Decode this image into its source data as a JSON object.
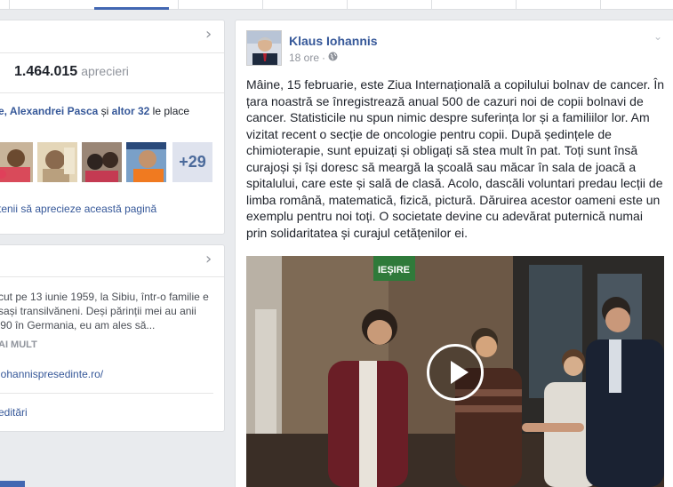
{
  "left": {
    "likes": {
      "count": "1.464.015",
      "label": "aprecieri"
    },
    "friends": {
      "first": "e, ",
      "name": "Alexandrei Pasca",
      "connector": " și ",
      "others": "altor 32",
      "suffix": " le place"
    },
    "plus_count": "+29",
    "invite_text": "tenii să aprecieze această pagină",
    "about": {
      "text": "cut pe 13 iunie 1959, la Sibiu, într-o familie e sași transilvăneni. Deși părinții mei au anii '90 în Germania, eu am ales să...",
      "more_label": "AI MULT",
      "website": "iohannispresedinte.ro/",
      "edits": "editări"
    }
  },
  "post": {
    "author": "Klaus Iohannis",
    "time": "18 ore",
    "privacy_sep": "·",
    "text": "Mâine, 15 februarie, este Ziua Internațională a copilului bolnav de cancer. În țara noastră se înregistrează anual 500 de cazuri noi de copii bolnavi de cancer. Statisticile nu spun nimic despre suferința lor și a familiilor lor. Am vizitat recent o secție de oncologie pentru copii. După ședințele de chimioterapie, sunt epuizați și obligați să stea mult în pat. Toți sunt însă curajoși și își doresc să meargă la școală sau măcar în sala de joacă a spitalului, care este și sală de clasă. Acolo, dascăli voluntari predau lecții de limba română, matematică, fizică, pictură. Dăruirea acestor oameni este un exemplu pentru noi toți. O societate devine cu adevărat puternică numai prin solidaritatea și curajul cetățenilor ei.",
    "video_sign": "IEŞIRE"
  }
}
